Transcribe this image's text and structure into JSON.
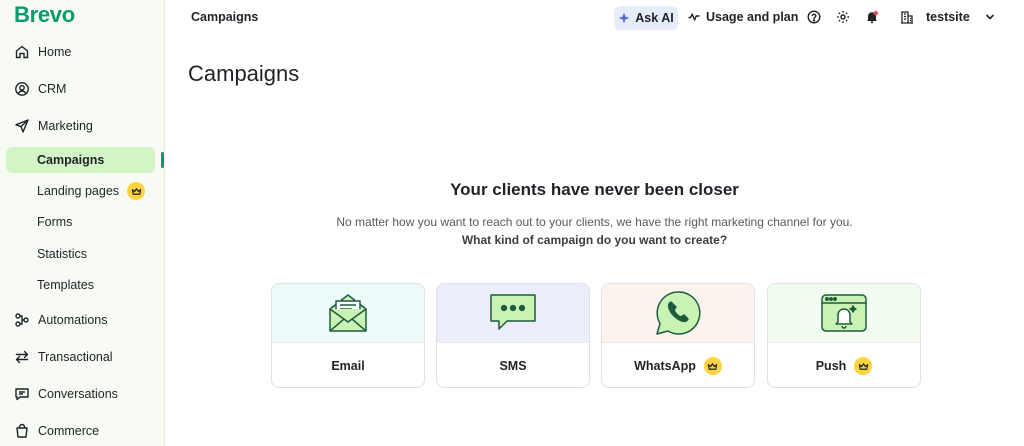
{
  "brand": "Brevo",
  "sidebar": {
    "items": [
      {
        "label": "Home",
        "icon": "home-icon"
      },
      {
        "label": "CRM",
        "icon": "contacts-icon"
      },
      {
        "label": "Marketing",
        "icon": "send-icon"
      },
      {
        "label": "Automations",
        "icon": "automation-icon"
      },
      {
        "label": "Transactional",
        "icon": "transfer-icon"
      },
      {
        "label": "Conversations",
        "icon": "chat-icon"
      },
      {
        "label": "Commerce",
        "icon": "bag-icon"
      }
    ],
    "marketing_sub": [
      {
        "label": "Campaigns",
        "active": true
      },
      {
        "label": "Landing pages",
        "premium": true
      },
      {
        "label": "Forms"
      },
      {
        "label": "Statistics"
      },
      {
        "label": "Templates"
      }
    ]
  },
  "topbar": {
    "breadcrumb": "Campaigns",
    "ask_ai": "Ask AI",
    "usage": "Usage and plan",
    "account": "testsite"
  },
  "main": {
    "title": "Campaigns",
    "hero_title": "Your clients have never been closer",
    "hero_sub": "No matter how you want to reach out to your clients, we have the right marketing channel for you.",
    "hero_question": "What kind of campaign do you want to create?",
    "channels": [
      {
        "label": "Email",
        "bg": "#ecfbf9",
        "premium": false
      },
      {
        "label": "SMS",
        "bg": "#ecedfb",
        "premium": false
      },
      {
        "label": "WhatsApp",
        "bg": "#fdf3ee",
        "premium": true
      },
      {
        "label": "Push",
        "bg": "#f1fbef",
        "premium": true
      }
    ]
  },
  "colors": {
    "brand": "#0b996e",
    "active_bg": "#d3f5c6",
    "crown": "#ffd23f",
    "illustration_green": "#c9f2b5",
    "outline": "#1e5b3e"
  }
}
